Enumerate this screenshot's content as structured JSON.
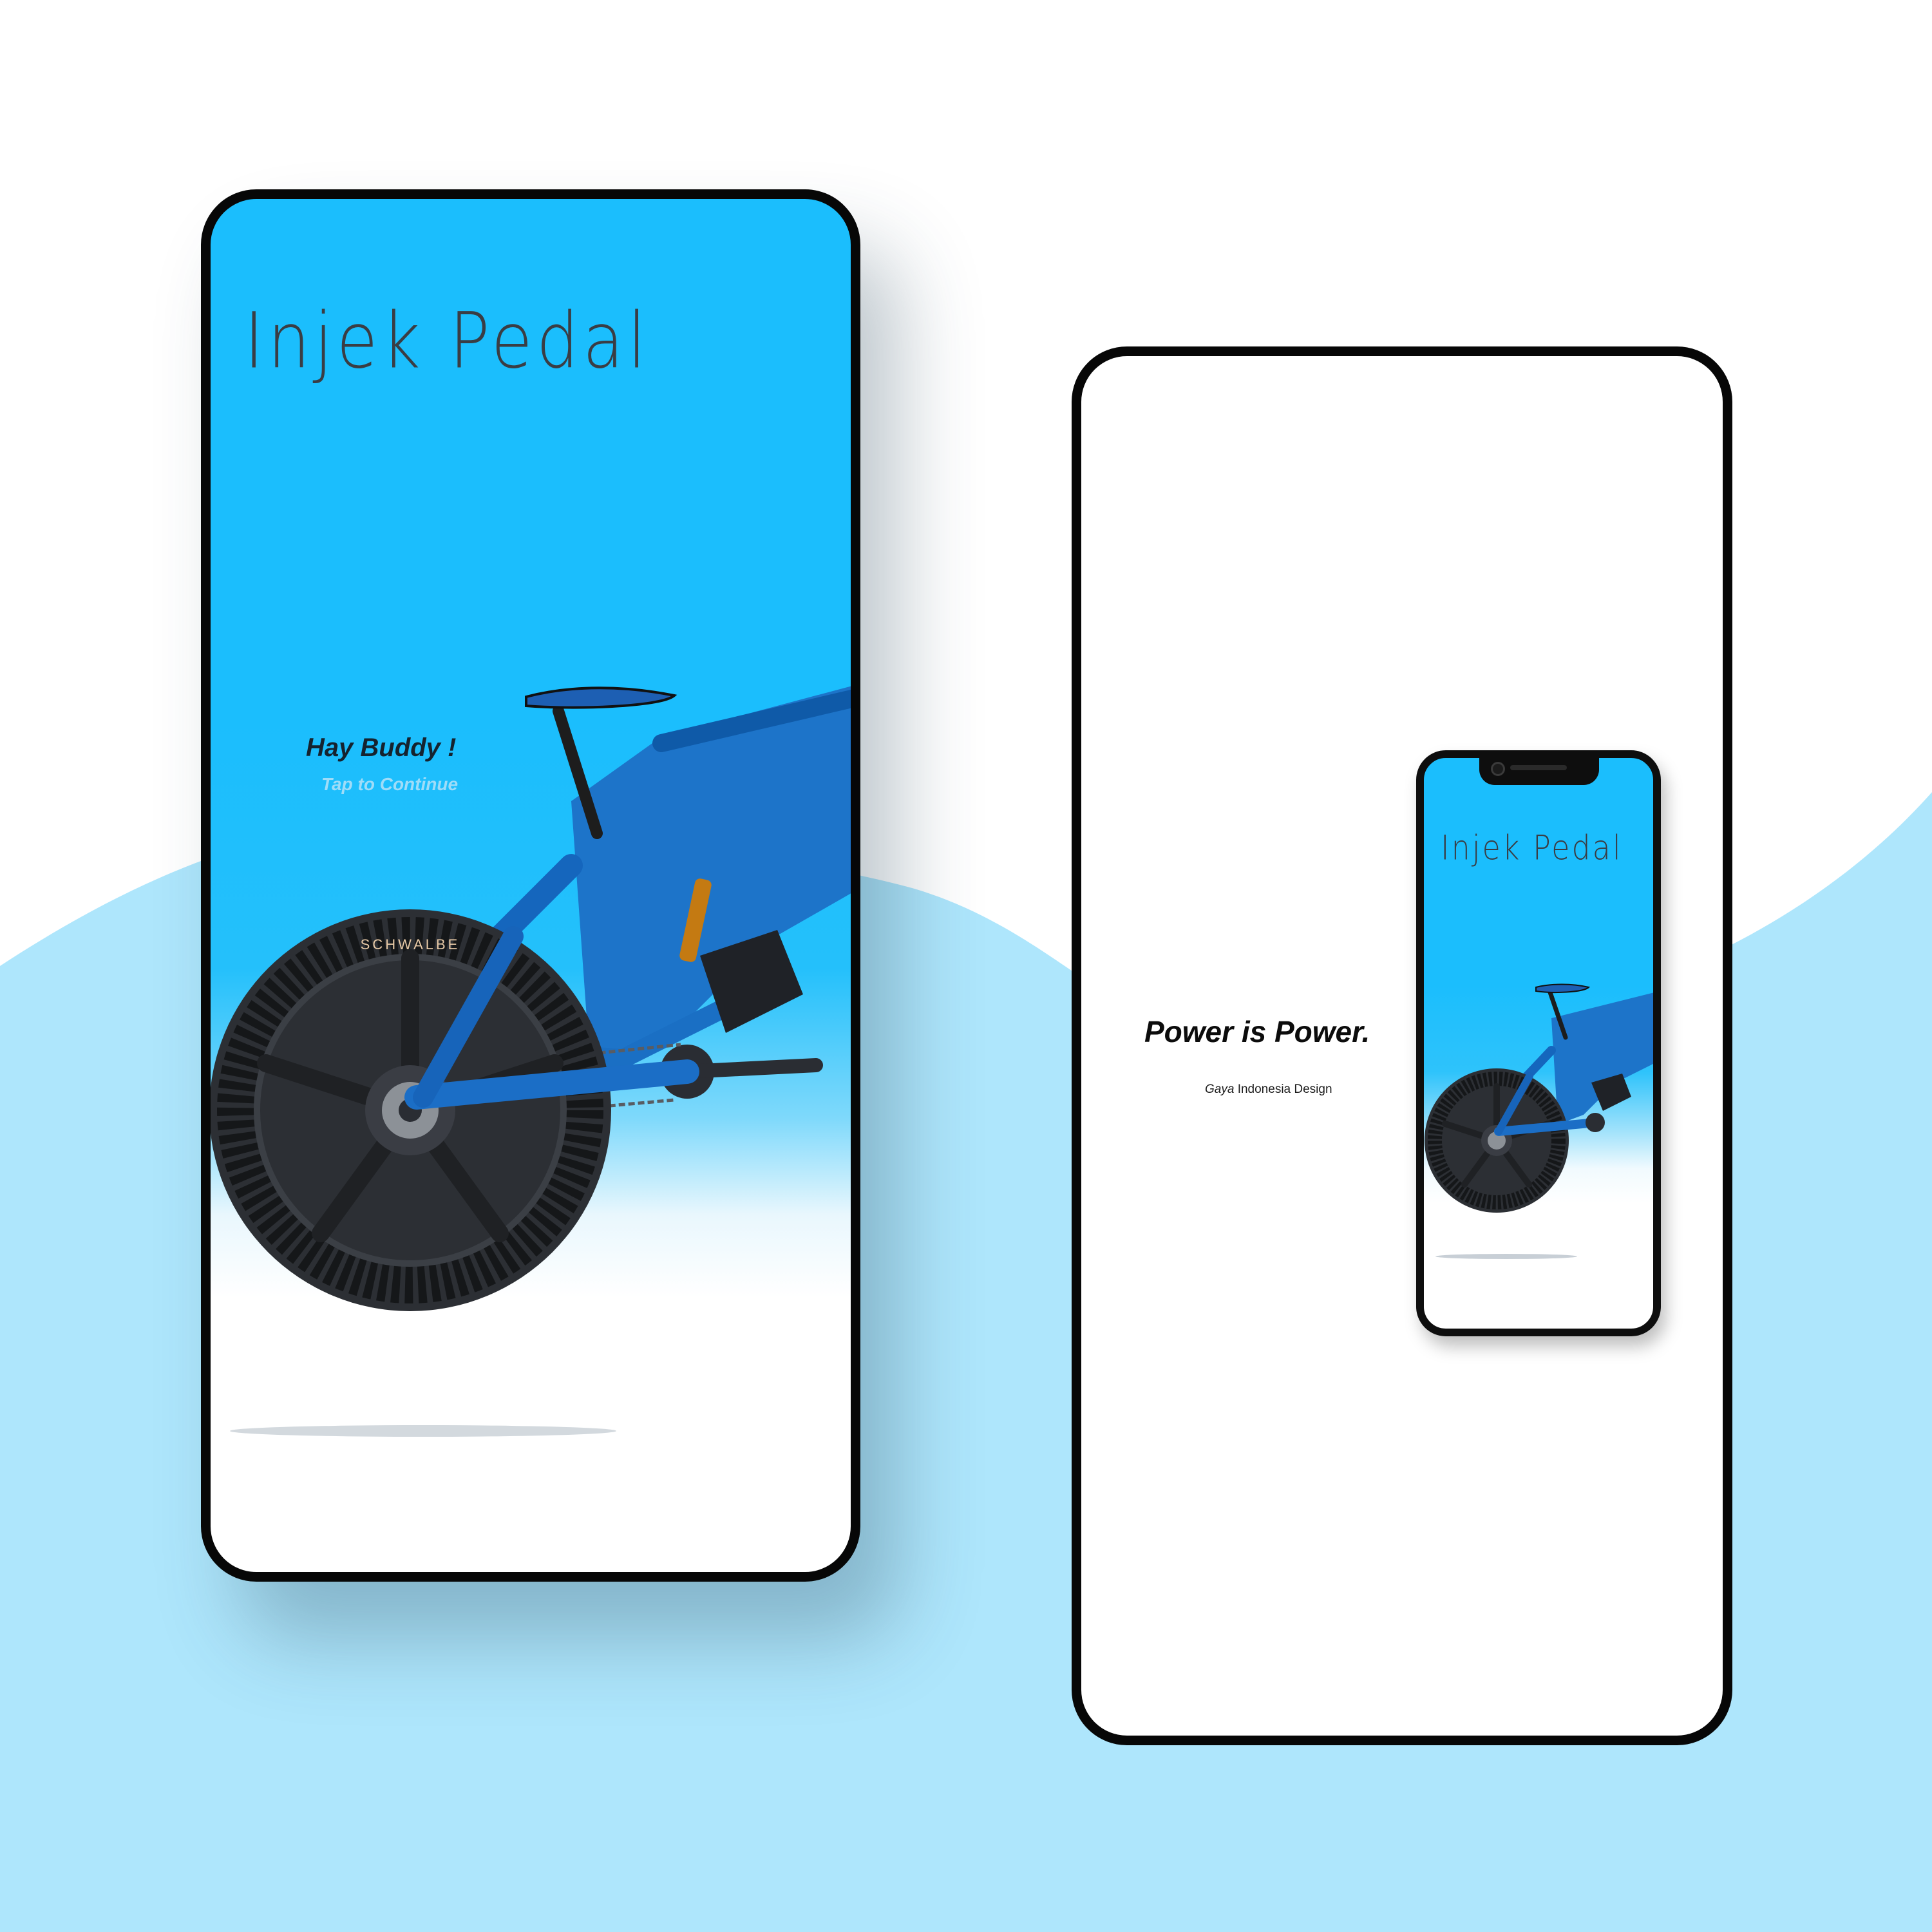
{
  "screen_1": {
    "brand": "Injek Pedal",
    "greeting": "Hay Buddy !",
    "cta": "Tap to Continue",
    "image": "bike-image",
    "colors": {
      "background": "#1bbefd",
      "fade": "#ffffff",
      "brand_text": "#3a3d44",
      "cta_text": "#9fdcf8"
    }
  },
  "screen_2": {
    "headline": "Power is Power.",
    "subtitle_italic": "Gaya",
    "subtitle_rest": " Indonesia Design",
    "preview": {
      "brand": "Injek Pedal",
      "image": "bike-image"
    },
    "colors": {
      "background": "#ffffff",
      "headline": "#0c0c0c"
    }
  },
  "backdrop": {
    "wave_color": "#aee6fc",
    "top_color": "#ffffff"
  }
}
